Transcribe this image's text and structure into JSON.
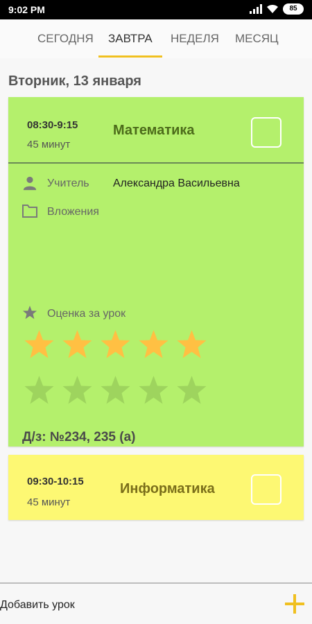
{
  "status_bar": {
    "time": "9:02 PM",
    "battery": "85"
  },
  "tabs": [
    {
      "label": "СЕГОДНЯ",
      "active": false
    },
    {
      "label": "ЗАВТРА",
      "active": true
    },
    {
      "label": "НЕДЕЛЯ",
      "active": false
    },
    {
      "label": "МЕСЯЦ",
      "active": false
    }
  ],
  "date_header": "Вторник, 13 января",
  "lessons": [
    {
      "time": "08:30-9:15",
      "duration": "45 минут",
      "subject": "Математика",
      "color": "#b4f06c",
      "checked": false,
      "teacher_label": "Учитель",
      "teacher": "Александра Васильевна",
      "attachments_label": "Вложения",
      "rating_label": "Оценка за урок",
      "rating_rows": [
        {
          "filled": 5,
          "total": 5
        },
        {
          "filled": 0,
          "total": 5
        }
      ],
      "homework": "Д/з: №234, 235 (а)"
    },
    {
      "time": "09:30-10:15",
      "duration": "45 минут",
      "subject": "Информатика",
      "color": "#fdf873",
      "checked": false
    }
  ],
  "bottom": {
    "add_label": "Добавить урок"
  },
  "colors": {
    "accent": "#f0c020",
    "star_filled": "#ffc043",
    "star_empty": "#9ed45e"
  }
}
